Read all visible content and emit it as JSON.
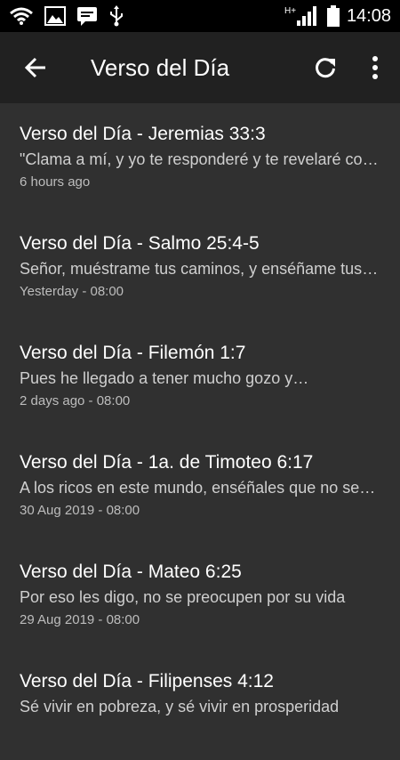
{
  "status_bar": {
    "time": "14:08",
    "network_type": "H+",
    "icons": [
      "wifi-icon",
      "image-icon",
      "message-icon",
      "usb-icon",
      "signal-icon",
      "battery-icon"
    ]
  },
  "app_bar": {
    "title": "Verso del Día",
    "actions": [
      "back-arrow-icon",
      "refresh-icon",
      "more-vert-icon"
    ]
  },
  "verses": [
    {
      "title": "Verso del Día - Jeremias 33:3",
      "snippet": "\"Clama a mí, y yo te responderé y te revelaré cosas grandes",
      "time": "6 hours ago"
    },
    {
      "title": "Verso del Día - Salmo 25:4-5",
      "snippet": "Señor, muéstrame tus caminos, y enséñame tus sendas",
      "time": "Yesterday - 08:00"
    },
    {
      "title": "Verso del Día - Filemón 1:7",
      "snippet": "Pues he llegado a tener mucho gozo y…",
      "time": "2 days ago - 08:00"
    },
    {
      "title": "Verso del Día - 1a. de Timoteo 6:17",
      "snippet": "A los ricos en este mundo, enséñales que no sean arrogantes",
      "time": "30 Aug 2019 - 08:00"
    },
    {
      "title": "Verso del Día - Mateo 6:25",
      "snippet": "Por eso les digo, no se preocupen por su vida",
      "time": "29 Aug 2019 - 08:00"
    },
    {
      "title": "Verso del Día - Filipenses 4:12",
      "snippet": "Sé vivir en pobreza, y sé vivir en prosperidad",
      "time": ""
    }
  ],
  "colors": {
    "background": "#303030",
    "app_bar": "#212121",
    "status_bar": "#000000",
    "text_primary": "#ffffff",
    "text_secondary": "#cfcfcf"
  }
}
